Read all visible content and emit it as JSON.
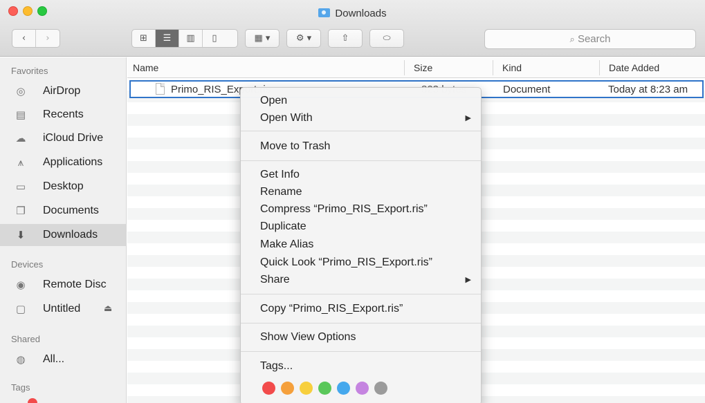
{
  "window": {
    "title": "Downloads"
  },
  "toolbar": {
    "back": "‹",
    "forward": "›",
    "search_placeholder": "Search"
  },
  "sidebar": {
    "favorites_label": "Favorites",
    "favorites": [
      {
        "label": "AirDrop",
        "icon": "airdrop-icon"
      },
      {
        "label": "Recents",
        "icon": "recents-icon"
      },
      {
        "label": "iCloud Drive",
        "icon": "cloud-icon"
      },
      {
        "label": "Applications",
        "icon": "applications-icon"
      },
      {
        "label": "Desktop",
        "icon": "desktop-icon"
      },
      {
        "label": "Documents",
        "icon": "documents-icon"
      },
      {
        "label": "Downloads",
        "icon": "downloads-icon",
        "selected": true
      }
    ],
    "devices_label": "Devices",
    "devices": [
      {
        "label": "Remote Disc",
        "icon": "disc-icon"
      },
      {
        "label": "Untitled",
        "icon": "drive-icon"
      }
    ],
    "shared_label": "Shared",
    "shared": [
      {
        "label": "All...",
        "icon": "network-icon"
      }
    ],
    "tags_label": "Tags"
  },
  "list": {
    "columns": [
      "Name",
      "Size",
      "Kind",
      "Date Added"
    ],
    "files": [
      {
        "name": "Primo_RIS_Export.ris",
        "size": "823 bytes",
        "kind": "Document",
        "date_added": "Today at 8:23 am"
      }
    ]
  },
  "context_menu": {
    "open": "Open",
    "open_with": "Open With",
    "move_to_trash": "Move to Trash",
    "get_info": "Get Info",
    "rename": "Rename",
    "compress": "Compress “Primo_RIS_Export.ris”",
    "duplicate": "Duplicate",
    "make_alias": "Make Alias",
    "quick_look": "Quick Look “Primo_RIS_Export.ris”",
    "share": "Share",
    "copy": "Copy “Primo_RIS_Export.ris”",
    "show_view_options": "Show View Options",
    "tags": "Tags...",
    "tag_colors": [
      "#f24b4b",
      "#f5a03c",
      "#f7cf3d",
      "#5ac75a",
      "#45a8ed",
      "#c584e0",
      "#9b9b9b"
    ]
  },
  "colors": {
    "selection": "#2f74c9",
    "sidebar_bg": "#f0f0f0"
  }
}
